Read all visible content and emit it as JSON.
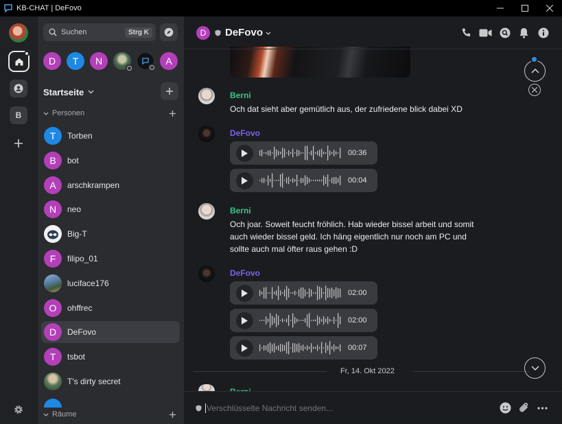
{
  "window": {
    "title": "KB-CHAT | DeFovo"
  },
  "rail": {
    "space_b_label": "B"
  },
  "sidebar": {
    "search_label": "Suchen",
    "search_shortcut": "Strg K",
    "top_avatars": [
      {
        "letter": "D",
        "color": "#b340b8"
      },
      {
        "letter": "T",
        "color": "#1e88e5"
      },
      {
        "letter": "N",
        "color": "#b340b8"
      },
      {
        "letter": "",
        "color": "#4a6b52"
      },
      {
        "letter": "",
        "color": "#111215"
      },
      {
        "letter": "A",
        "color": "#b340b8"
      }
    ],
    "home_title": "Startseite",
    "section_people": "Personen",
    "section_rooms": "Räume",
    "people": [
      {
        "name": "Torben",
        "letter": "T",
        "color": "#1e88e5"
      },
      {
        "name": "bot",
        "letter": "B",
        "color": "#b340b8"
      },
      {
        "name": "arschkrampen",
        "letter": "A",
        "color": "#b340b8"
      },
      {
        "name": "neo",
        "letter": "N",
        "color": "#b340b8"
      },
      {
        "name": "Big-T",
        "letter": "",
        "color": "#f2f2f2"
      },
      {
        "name": "filipo_01",
        "letter": "F",
        "color": "#b340b8"
      },
      {
        "name": "luciface176",
        "letter": "",
        "color": "#6b8fb5"
      },
      {
        "name": "ohffrec",
        "letter": "O",
        "color": "#b340b8"
      },
      {
        "name": "DeFovo",
        "letter": "D",
        "color": "#b340b8"
      },
      {
        "name": "tsbot",
        "letter": "T",
        "color": "#b340b8"
      },
      {
        "name": "T's dirty secret",
        "letter": "",
        "color": "#5a7a5a"
      }
    ]
  },
  "header": {
    "room_name": "DeFovo",
    "room_letter": "D"
  },
  "messages": [
    {
      "sender": "Berni",
      "text": "Och dat sieht aber gemütlich aus, der zufriedene blick dabei XD"
    },
    {
      "sender": "DeFovo",
      "voice": [
        "00:36",
        "00:04"
      ]
    },
    {
      "sender": "Berni",
      "text": "Och joar. Soweit feucht fröhlich. Hab wieder bissel arbeit und somit auch wieder bissel geld. Ich häng eigentlich nur noch am PC und sollte auch mal öfter raus gehen :D"
    },
    {
      "sender": "DeFovo",
      "voice": [
        "02:00",
        "02:00",
        "00:07"
      ]
    },
    {
      "sender": "Berni"
    }
  ],
  "date_separator": "Fr, 14. Okt 2022",
  "composer": {
    "placeholder": "Verschlüsselte Nachricht senden..."
  },
  "colors": {
    "berni": "#38c58a",
    "defovo": "#7d62e9",
    "accent": "#b340b8"
  }
}
